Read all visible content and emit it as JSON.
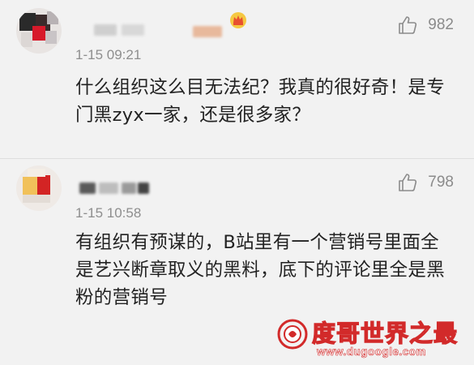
{
  "comments": [
    {
      "likes": "982",
      "timestamp": "1-15 09:21",
      "text": "什么组织这么目无法纪？我真的很好奇！是专门黑zyx一家，还是很多家？"
    },
    {
      "likes": "798",
      "timestamp": "1-15 10:58",
      "text": "有组织有预谋的，B站里有一个营销号里面全是艺兴断章取义的黑料，底下的评论里全是黑粉的营销号"
    }
  ],
  "watermark": {
    "title": "度哥世界之最",
    "url": "www.dugoogle.com"
  },
  "icons": {
    "like": "thumbs-up-icon",
    "vip": "vip-crown-badge-icon",
    "watermark_logo": "dugoogle-logo-icon"
  },
  "colors": {
    "background": "#f2f2f2",
    "text": "#222222",
    "meta": "#8e8e8e",
    "watermark": "#d22a2a"
  }
}
